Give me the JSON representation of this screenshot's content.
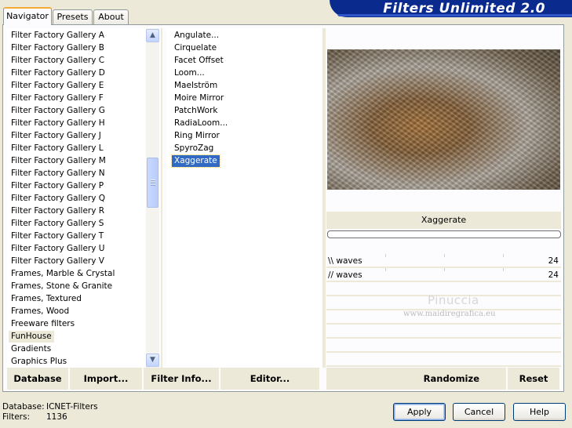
{
  "window": {
    "banner_title": "Filters Unlimited 2.0"
  },
  "tabs": [
    {
      "label": "Navigator"
    },
    {
      "label": "Presets"
    },
    {
      "label": "About"
    }
  ],
  "categories": {
    "items": [
      "Filter Factory Gallery A",
      "Filter Factory Gallery B",
      "Filter Factory Gallery C",
      "Filter Factory Gallery D",
      "Filter Factory Gallery E",
      "Filter Factory Gallery F",
      "Filter Factory Gallery G",
      "Filter Factory Gallery H",
      "Filter Factory Gallery J",
      "Filter Factory Gallery L",
      "Filter Factory Gallery M",
      "Filter Factory Gallery N",
      "Filter Factory Gallery P",
      "Filter Factory Gallery Q",
      "Filter Factory Gallery R",
      "Filter Factory Gallery S",
      "Filter Factory Gallery T",
      "Filter Factory Gallery U",
      "Filter Factory Gallery V",
      "Frames, Marble & Crystal",
      "Frames, Stone & Granite",
      "Frames, Textured",
      "Frames, Wood",
      "Freeware filters",
      "FunHouse",
      "Gradients",
      "Graphics Plus"
    ],
    "selected": "FunHouse"
  },
  "filters": {
    "items": [
      "Angulate...",
      "Cirquelate",
      "Facet Offset",
      "Loom...",
      "Maelström",
      "Moire Mirror",
      "PatchWork",
      "RadiaLoom...",
      "Ring Mirror",
      "SpyroZag",
      "Xaggerate"
    ],
    "selected": "Xaggerate"
  },
  "preview": {
    "filter_name": "Xaggerate",
    "watermark": "Pinuccia",
    "watermark_url": "www.maidiregrafica.eu"
  },
  "params": [
    {
      "name": "\\\\ waves",
      "value": "24"
    },
    {
      "name": "// waves",
      "value": "24"
    }
  ],
  "actions": {
    "database": "Database",
    "import": "Import...",
    "filter_info": "Filter Info...",
    "editor": "Editor...",
    "randomize": "Randomize",
    "reset": "Reset"
  },
  "status": {
    "database_label": "Database:",
    "database_value": "ICNET-Filters",
    "filters_label": "Filters:",
    "filters_value": "1136"
  },
  "buttons": {
    "apply": "Apply",
    "cancel": "Cancel",
    "help": "Help"
  },
  "colors": {
    "banner": "#0b2a8e",
    "selection": "#316ac5",
    "window_bg": "#ece9d8"
  }
}
